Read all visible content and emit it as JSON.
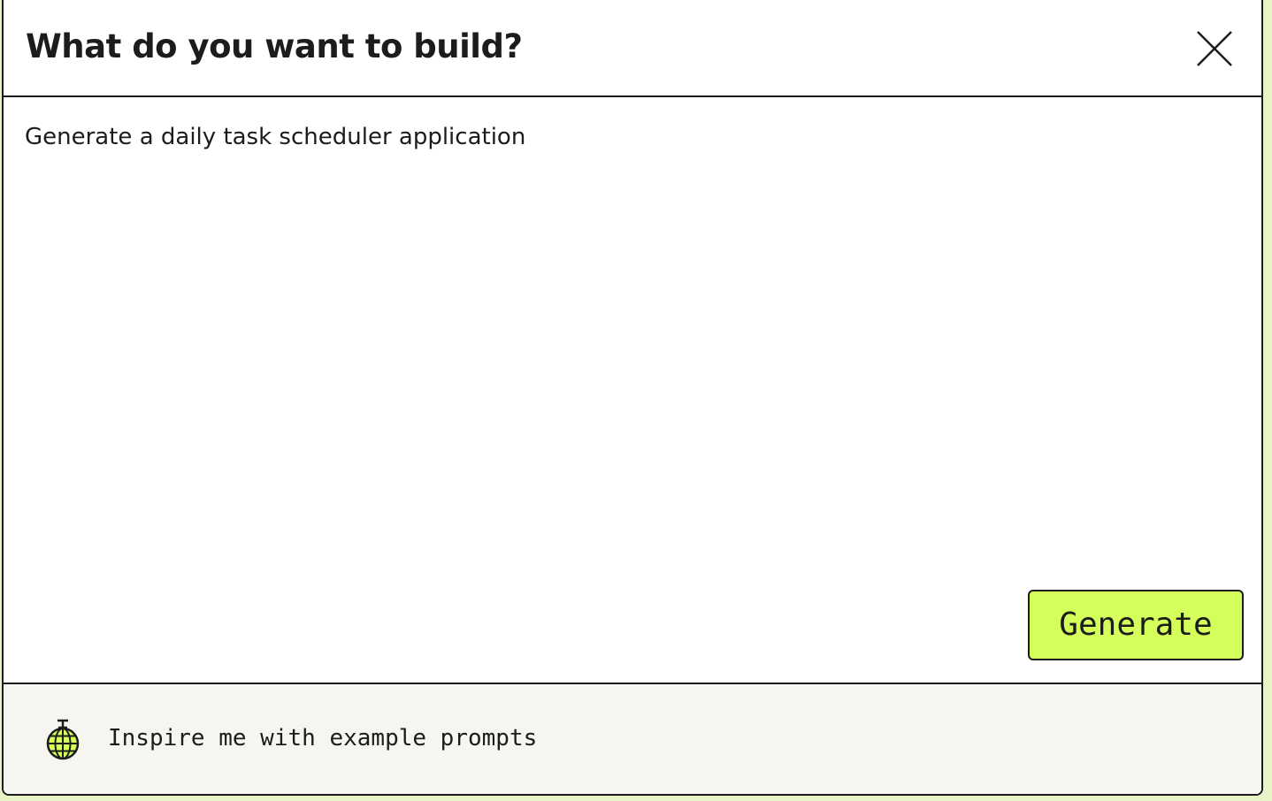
{
  "dialog": {
    "title": "What do you want to build?",
    "close_icon": "close-icon"
  },
  "prompt": {
    "value": "Generate a daily task scheduler application"
  },
  "actions": {
    "generate_label": "Generate"
  },
  "footer": {
    "icon": "disco-ball-icon",
    "inspire_label": "Inspire me with example prompts"
  },
  "colors": {
    "accent": "#d4ff5a",
    "border": "#1c1c1c",
    "footer_bg": "#f6f5f0",
    "background": "#e9f3c8"
  }
}
